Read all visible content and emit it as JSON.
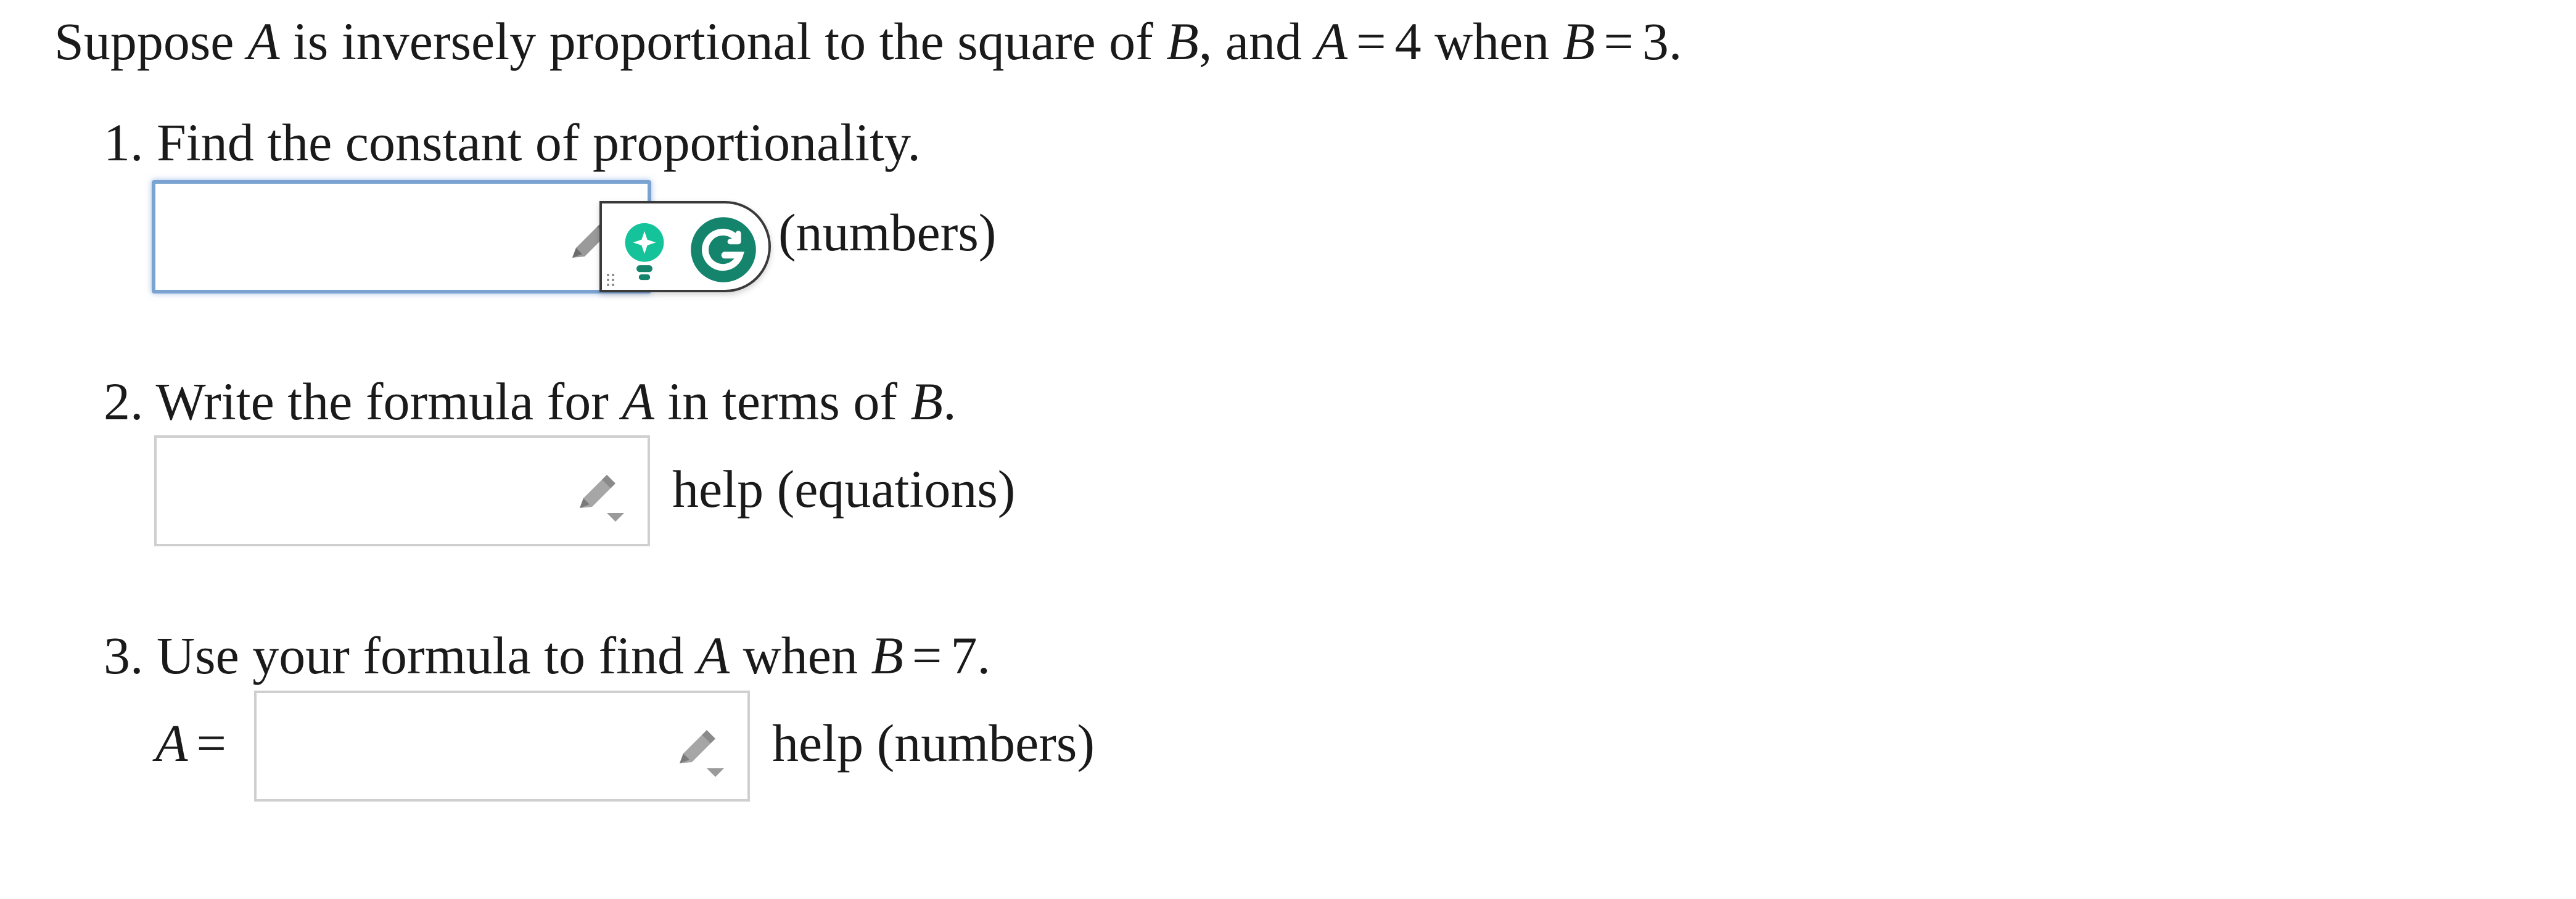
{
  "intro": {
    "prefix": "Suppose ",
    "var_a": "A",
    "middle": " is inversely proportional to the square of ",
    "var_b": "B",
    "comma": ", and ",
    "var_a2": "A",
    "eq": "=",
    "val_a": "4",
    "when": " when ",
    "var_b2": "B",
    "eq2": "=",
    "val_b": "3."
  },
  "questions": [
    {
      "number": "1.",
      "text": "Find the constant of proportionality.",
      "help_label": "(numbers)",
      "input_value": ""
    },
    {
      "number": "2.",
      "text_before": "Write the formula for ",
      "var_a": "A",
      "text_middle": " in terms of ",
      "var_b": "B",
      "text_after": ".",
      "help_label": "help (equations)",
      "input_value": ""
    },
    {
      "number": "3.",
      "text_before": "Use your formula to find ",
      "var_a": "A",
      "text_middle": " when ",
      "var_b": "B",
      "eq": "=",
      "value": "7.",
      "answer_var": "A",
      "answer_eq": "=",
      "help_label": "help (numbers)",
      "input_value": ""
    }
  ],
  "icons": {
    "pencil": "pencil-edit-icon",
    "grammarly_bulb": "lightbulb-icon",
    "grammarly_logo": "grammarly-g-icon"
  },
  "colors": {
    "focus_border": "#7aa3d1",
    "grammarly_green": "#15846d",
    "bulb_teal": "#15c39a"
  }
}
